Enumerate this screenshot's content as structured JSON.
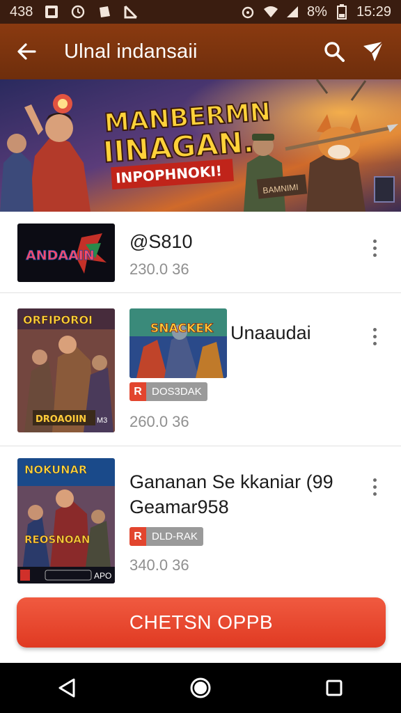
{
  "status_bar": {
    "time_left": "438",
    "battery": "8%",
    "clock": "15:29"
  },
  "toolbar": {
    "title": "Ulnal indansaii"
  },
  "banner": {
    "headline_1": "MANBERMN",
    "headline_2": "IINAGAN.",
    "ribbon": "INPOPHNOKI!",
    "sign": "BAMNIMI"
  },
  "items": [
    {
      "thumb_text": "ANDAAIN",
      "name": "@S810",
      "meta": "230.0 36"
    },
    {
      "thumb_text": "ORFIPOROI",
      "thumb_bottom": "DROAOIIN",
      "thumb_badge": "M3",
      "screenshot_text": "SNACKEK",
      "name": "Unaaudai",
      "tag": "DOS3DAK",
      "meta": "260.0 36"
    },
    {
      "thumb_text": "NOKUNAR",
      "thumb_bottom": "REOSNOAN",
      "thumb_badge": "APO",
      "name_line1": "Gananan Se kkaniar (99",
      "name_line2": "Geamar958",
      "tag": "DLD-RAK",
      "meta": "340.0 36"
    }
  ],
  "cta": {
    "label": "CHETSN OPPB"
  },
  "colors": {
    "toolbar": "#7a3210",
    "accent": "#e8452e",
    "statusbar": "#3a1d10"
  }
}
